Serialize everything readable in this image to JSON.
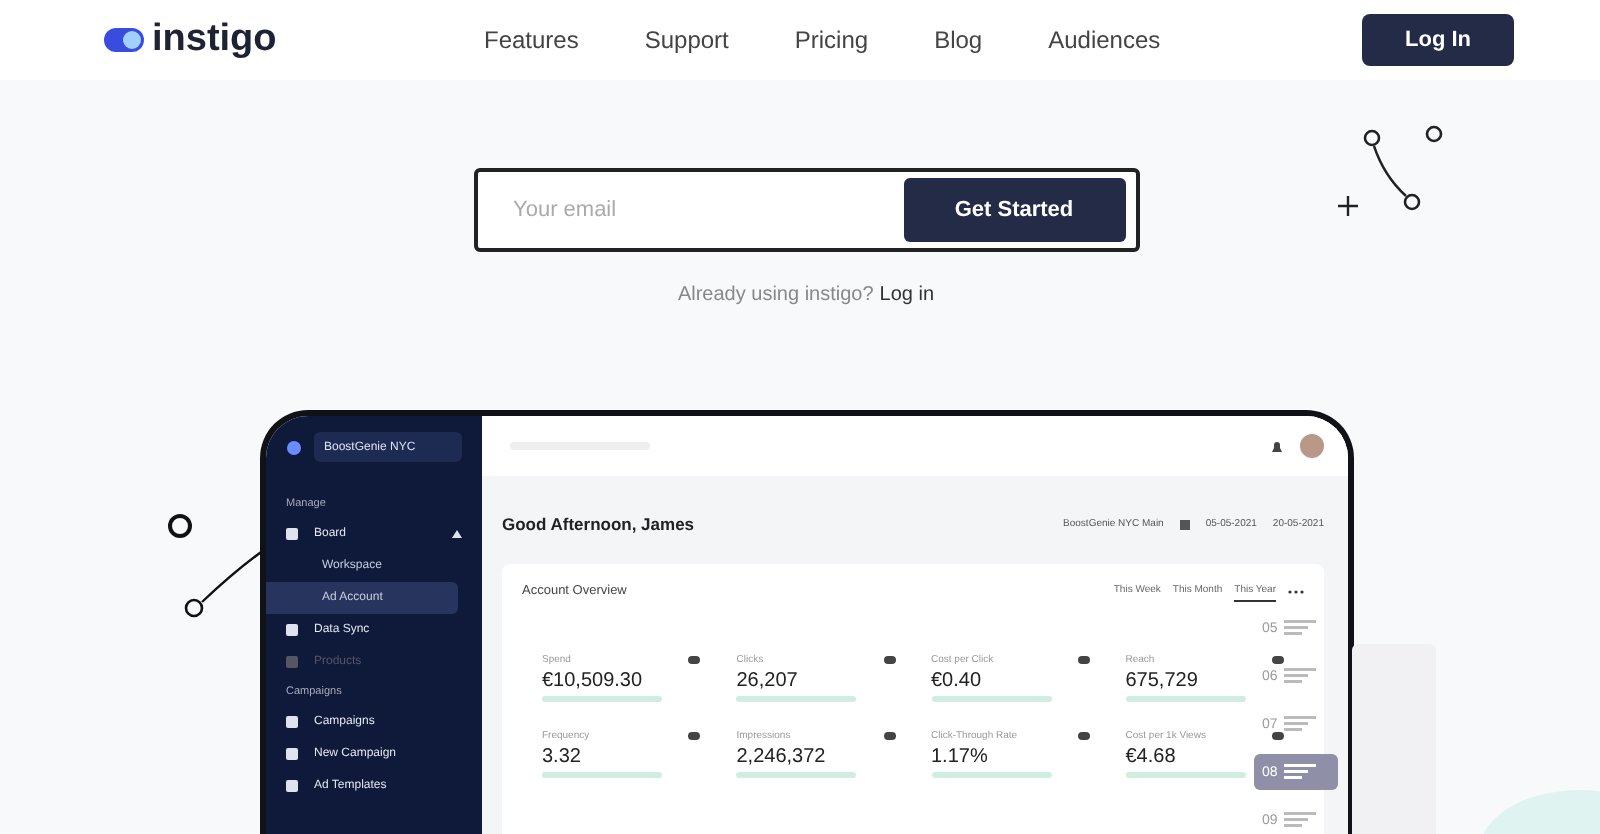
{
  "header": {
    "brand": "instigo",
    "nav": [
      {
        "label": "Features"
      },
      {
        "label": "Support"
      },
      {
        "label": "Pricing"
      },
      {
        "label": "Blog"
      },
      {
        "label": "Audiences"
      }
    ],
    "login": "Log In"
  },
  "signup": {
    "placeholder": "Your email",
    "button": "Get Started",
    "prompt": "Already using instigo?",
    "link": "Log in"
  },
  "app": {
    "workspace": "BoostGenie NYC",
    "sidebar": [
      {
        "kind": "section",
        "label": "Manage"
      },
      {
        "kind": "item",
        "label": "Board",
        "expanded": true,
        "selected": false,
        "children": [
          {
            "label": "Workspace",
            "selected": false
          },
          {
            "label": "Ad Account",
            "selected": true
          }
        ]
      },
      {
        "kind": "item",
        "label": "Data Sync",
        "selected": false
      },
      {
        "kind": "item",
        "label": "Products",
        "selected": false,
        "disabled": true
      },
      {
        "kind": "section",
        "label": "Campaigns"
      },
      {
        "kind": "item",
        "label": "Campaigns",
        "selected": false
      },
      {
        "kind": "item",
        "label": "New Campaign",
        "selected": false
      },
      {
        "kind": "item",
        "label": "Ad Templates",
        "selected": false
      }
    ],
    "greeting": "Good Afternoon, James",
    "account": "BoostGenie NYC Main",
    "date_from": "05-05-2021",
    "date_to": "20-05-2021",
    "overview": {
      "title": "Account Overview",
      "tabs": [
        {
          "label": "This Week",
          "selected": false
        },
        {
          "label": "This Month",
          "selected": false
        },
        {
          "label": "This Year",
          "selected": true
        }
      ],
      "metrics": [
        {
          "label": "Spend",
          "value": "€10,509.30"
        },
        {
          "label": "Clicks",
          "value": "26,207"
        },
        {
          "label": "Cost per Click",
          "value": "€0.40"
        },
        {
          "label": "Reach",
          "value": "675,729"
        },
        {
          "label": "Frequency",
          "value": "3.32"
        },
        {
          "label": "Impressions",
          "value": "2,246,372"
        },
        {
          "label": "Click-Through Rate",
          "value": "1.17%"
        },
        {
          "label": "Cost per 1k Views",
          "value": "€4.68"
        }
      ]
    },
    "steps": [
      {
        "label": "05",
        "selected": false
      },
      {
        "label": "06",
        "selected": false
      },
      {
        "label": "07",
        "selected": false
      },
      {
        "label": "08",
        "selected": true
      },
      {
        "label": "09",
        "selected": false
      }
    ]
  }
}
